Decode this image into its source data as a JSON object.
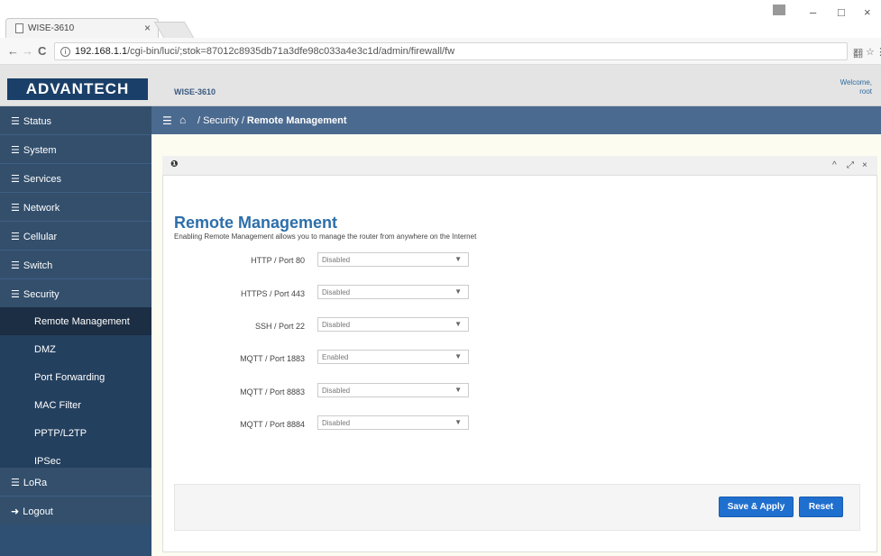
{
  "browser": {
    "tab_title": "WISE-3610",
    "tab_close": "×",
    "url_host": "192.168.1.1",
    "url_path": "/cgi-bin/luci/;stok=87012c8935db71a3dfe98c033a4e3c1d/admin/firewall/fw",
    "back": "←",
    "forward": "→",
    "reload": "C",
    "info": "i",
    "minimize": "–",
    "maximize": "□",
    "close": "×",
    "translate_icon": "翻",
    "star_icon": "☆",
    "menu_icon": "⋮"
  },
  "header": {
    "logo": "ADVANTECH",
    "device": "WISE-3610",
    "welcome_line1": "Welcome,",
    "welcome_line2": "root"
  },
  "sidebar": {
    "items": [
      {
        "label": "Status"
      },
      {
        "label": "System"
      },
      {
        "label": "Services"
      },
      {
        "label": "Network"
      },
      {
        "label": "Cellular"
      },
      {
        "label": "Switch"
      },
      {
        "label": "Security"
      },
      {
        "label": "Remote Management"
      },
      {
        "label": "DMZ"
      },
      {
        "label": "Port Forwarding"
      },
      {
        "label": "MAC Filter"
      },
      {
        "label": "PPTP/L2TP"
      },
      {
        "label": "IPSec"
      },
      {
        "label": "LoRa"
      },
      {
        "label": "Logout"
      }
    ]
  },
  "breadcrumb": {
    "sep": "/",
    "section": "Security",
    "page": "Remote Management"
  },
  "panel": {
    "info_icon": "i",
    "collapse_icon": "^",
    "expand_icon": "⤢",
    "close_icon": "×"
  },
  "main": {
    "title": "Remote Management",
    "description": "Enabling Remote Management allows you to manage the router from anywhere on the Internet",
    "fields": [
      {
        "label": "HTTP / Port 80",
        "value": "Disabled"
      },
      {
        "label": "HTTPS / Port 443",
        "value": "Disabled"
      },
      {
        "label": "SSH / Port 22",
        "value": "Disabled"
      },
      {
        "label": "MQTT / Port 1883",
        "value": "Enabled"
      },
      {
        "label": "MQTT / Port 8883",
        "value": "Disabled"
      },
      {
        "label": "MQTT / Port 8884",
        "value": "Disabled"
      }
    ],
    "save_label": "Save & Apply",
    "reset_label": "Reset"
  },
  "colors": {
    "brand": "#1a3f68",
    "sidebar": "#2f4f73",
    "crumbbar": "#4b6a8f",
    "title": "#2d6fa9",
    "button": "#1f6fcf"
  }
}
